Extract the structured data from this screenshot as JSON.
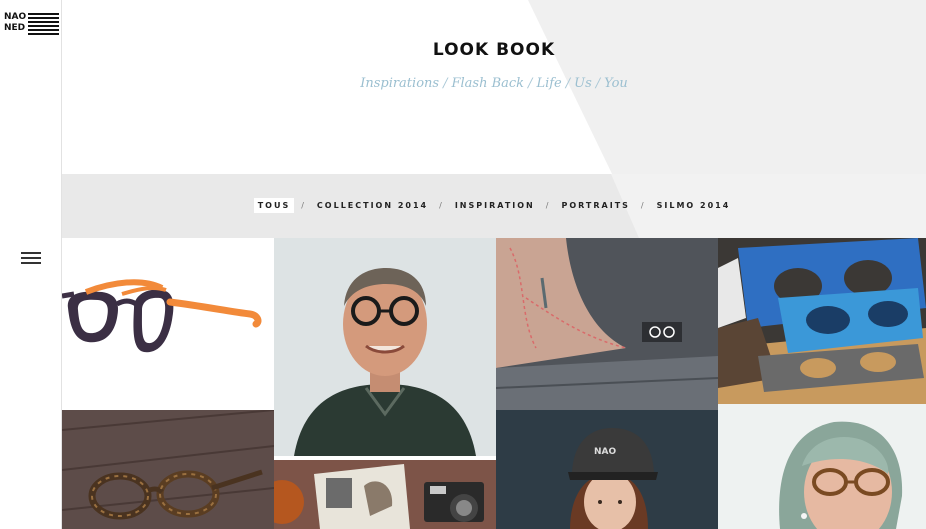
{
  "logo": {
    "line1": "NAO",
    "line2": "NED"
  },
  "header": {
    "title": "LOOK BOOK",
    "subnav": [
      "Inspirations",
      "Flash Back",
      "Life",
      "Us",
      "You"
    ]
  },
  "filters": [
    "TOUS",
    "COLLECTION 2014",
    "INSPIRATION",
    "PORTRAITS",
    "SILMO 2014"
  ],
  "active_filter": "TOUS",
  "gallery": [
    {
      "name": "photo-orange-purple-glasses",
      "icon": "eyeglasses-icon"
    },
    {
      "name": "photo-man-round-glasses",
      "icon": "portrait-icon"
    },
    {
      "name": "photo-tattooed-arm-tshirt",
      "icon": "tattoo-icon"
    },
    {
      "name": "photo-colorful-frame-cutouts",
      "icon": "frames-icon"
    },
    {
      "name": "photo-tortoise-glasses-wood",
      "icon": "eyeglasses-icon"
    },
    {
      "name": "photo-magazine-camera",
      "icon": "camera-icon"
    },
    {
      "name": "photo-woman-cap",
      "icon": "portrait-icon"
    },
    {
      "name": "photo-woman-grey-hair-glasses",
      "icon": "portrait-icon"
    }
  ],
  "colors": {
    "accent_link": "#9bbfd0",
    "band": "#e9e9e9",
    "title": "#111111"
  }
}
